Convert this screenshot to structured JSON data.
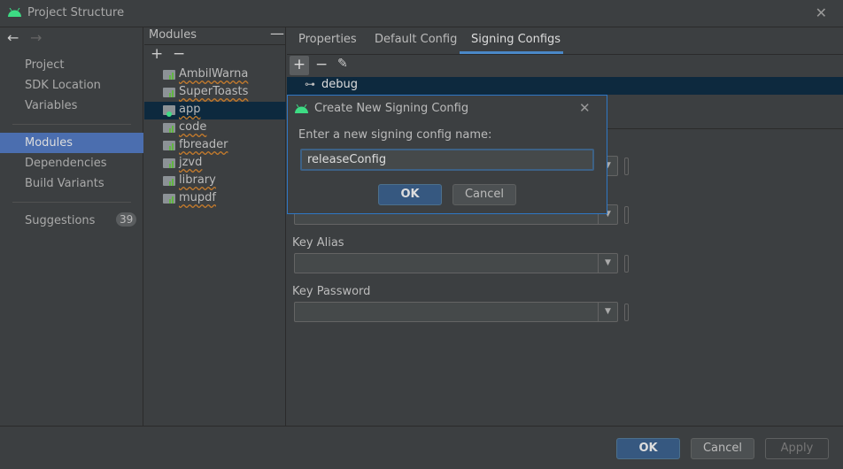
{
  "window": {
    "title": "Project Structure"
  },
  "sidebar": {
    "items": [
      {
        "label": "Project"
      },
      {
        "label": "SDK Location"
      },
      {
        "label": "Variables"
      },
      {
        "label": "Modules"
      },
      {
        "label": "Dependencies"
      },
      {
        "label": "Build Variants"
      },
      {
        "label": "Suggestions",
        "badge": "39"
      }
    ],
    "selected": "Modules"
  },
  "modules": {
    "header": "Modules",
    "items": [
      "AmbilWarna",
      "SuperToasts",
      "app",
      "code",
      "fbreader",
      "jzvd",
      "library",
      "mupdf"
    ],
    "selected": "app"
  },
  "tabs": [
    {
      "label": "Properties"
    },
    {
      "label": "Default Config"
    },
    {
      "label": "Signing Configs",
      "active": true
    }
  ],
  "signing": {
    "configs": [
      "debug"
    ],
    "fields": [
      {
        "label": "Key Alias",
        "value": ""
      },
      {
        "label": "Key Password",
        "value": ""
      }
    ]
  },
  "dialog": {
    "title": "Create New Signing Config",
    "prompt": "Enter a new signing config name:",
    "value": "releaseConfig",
    "ok": "OK",
    "cancel": "Cancel"
  },
  "footer": {
    "ok": "OK",
    "cancel": "Cancel",
    "apply": "Apply"
  },
  "colors": {
    "accent": "#4b6eaf",
    "android": "#3ddc84",
    "primary_button": "#365880"
  }
}
